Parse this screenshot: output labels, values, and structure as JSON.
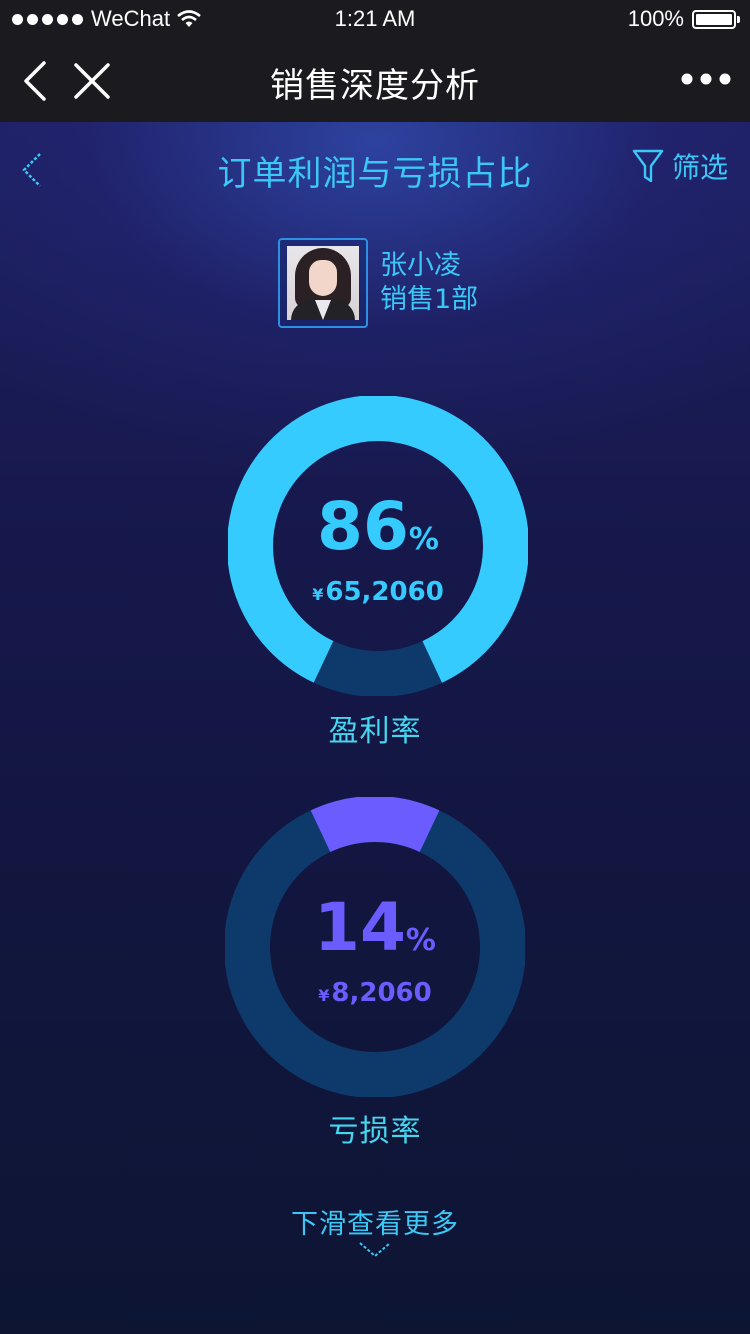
{
  "status_bar": {
    "carrier": "WeChat",
    "time": "1:21 AM",
    "battery": "100%"
  },
  "nav": {
    "title": "销售深度分析"
  },
  "header": {
    "title": "订单利润与亏损占比",
    "filter_label": "筛选"
  },
  "profile": {
    "name": "张小凌",
    "department": "销售1部"
  },
  "chart_data": [
    {
      "type": "pie",
      "label": "盈利率",
      "percent": 86,
      "percent_text": "86",
      "amount": "65,2060",
      "currency": "¥",
      "colors": {
        "value": "#36cbff",
        "remainder": "#0e3a6b"
      }
    },
    {
      "type": "pie",
      "label": "亏损率",
      "percent": 14,
      "percent_text": "14",
      "amount": "8,2060",
      "currency": "¥",
      "colors": {
        "value": "#6b5cff",
        "remainder": "#0e3a6b"
      }
    }
  ],
  "footer": {
    "hint": "下滑查看更多"
  },
  "colors": {
    "accent": "#3bc8f6",
    "background": "#0f1637"
  },
  "icons": {
    "back": "chevron-left-icon",
    "close": "close-icon",
    "more": "more-dots-icon",
    "filter": "funnel-icon",
    "scroll": "chevron-down-icon"
  }
}
